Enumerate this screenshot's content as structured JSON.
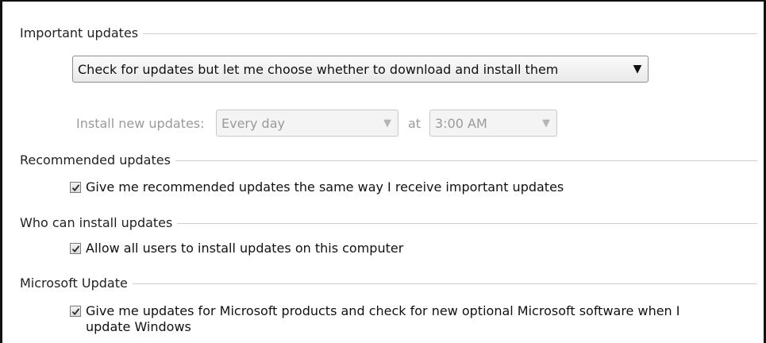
{
  "important_updates": {
    "title": "Important updates",
    "selected_option": "Check for updates but let me choose whether to download and install them",
    "install_label": "Install new updates:",
    "day_value": "Every day",
    "at_label": "at",
    "time_value": "3:00 AM"
  },
  "recommended_updates": {
    "title": "Recommended updates",
    "checkbox_label": "Give me recommended updates the same way I receive important updates",
    "checked": true
  },
  "who_can_install": {
    "title": "Who can install updates",
    "checkbox_label": "Allow all users to install updates on this computer",
    "checked": true
  },
  "microsoft_update": {
    "title": "Microsoft Update",
    "checkbox_label_line1": "Give me updates for Microsoft products and check for new optional Microsoft software when I",
    "checkbox_label_line2": "update Windows",
    "checked": true
  },
  "icons": {
    "dropdown": "chevron-down-icon",
    "check": "check-icon"
  }
}
